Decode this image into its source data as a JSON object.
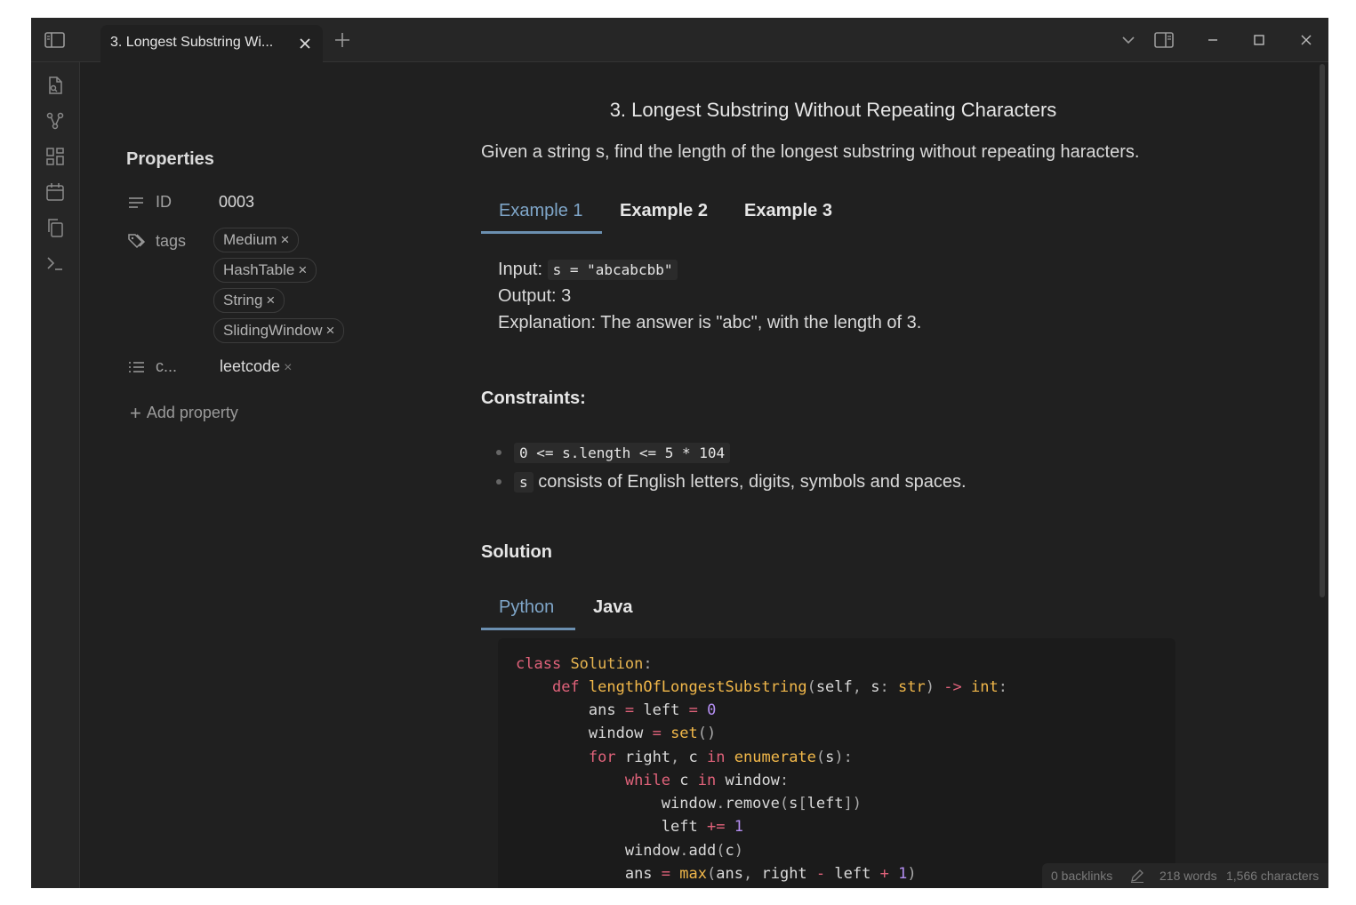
{
  "titlebar": {
    "tab_title": "3. Longest Substring Wi...",
    "icons": [
      "sidebar-toggle-icon",
      "close-icon",
      "plus-icon",
      "chevron-down-icon",
      "split-view-icon",
      "minimize-icon",
      "maximize-icon",
      "close-window-icon"
    ]
  },
  "ribbon": {
    "icons": [
      "open-file-icon",
      "graph-icon",
      "canvas-icon",
      "calendar-icon",
      "copy-icon",
      "terminal-icon"
    ]
  },
  "properties": {
    "heading": "Properties",
    "id_key": "ID",
    "id_value": "0003",
    "tags_key": "tags",
    "tags": [
      "Medium",
      "HashTable",
      "String",
      "SlidingWindow"
    ],
    "category_key": "c...",
    "category_value": "leetcode",
    "add_property": "Add property",
    "remove_glyph": "×"
  },
  "doc": {
    "title": "3. Longest Substring Without Repeating Characters",
    "intro": "Given a string s, find the length of the longest substring without repeating haracters.",
    "example_tabs": [
      "Example 1",
      "Example 2",
      "Example 3"
    ],
    "example": {
      "input_label": "Input:",
      "input_code": "s = \"abcabcbb\"",
      "output": "Output: 3",
      "explanation": "Explanation: The answer is \"abc\", with the length of 3."
    },
    "constraints_heading": "Constraints:",
    "constraint1_code": "0 <= s.length <= 5 * 104",
    "constraint2_code": "s",
    "constraint2_text": "consists of English letters, digits, symbols and spaces.",
    "solution_heading": "Solution",
    "solution_tabs": [
      "Python",
      "Java"
    ]
  },
  "code": {
    "class_kw": "class",
    "class_name": "Solution",
    "def_kw": "def",
    "fn_name": "lengthOfLongestSubstring",
    "param_self": "self",
    "param_s": "s",
    "type_str": "str",
    "type_int": "int",
    "ans": "ans",
    "left": "left",
    "zero": "0",
    "window": "window",
    "set": "set",
    "for_kw": "for",
    "right": "right",
    "c": "c",
    "in_kw": "in",
    "enumerate": "enumerate",
    "while_kw": "while",
    "remove": "remove",
    "one": "1",
    "add": "add",
    "max": "max"
  },
  "status": {
    "backlinks": "0 backlinks",
    "words": "218 words",
    "characters": "1,566 characters"
  },
  "colors": {
    "background": "#202020",
    "accent": "#7fa6c9",
    "keyword": "#e0627a",
    "function": "#f2b84a",
    "number": "#b48ef2"
  }
}
